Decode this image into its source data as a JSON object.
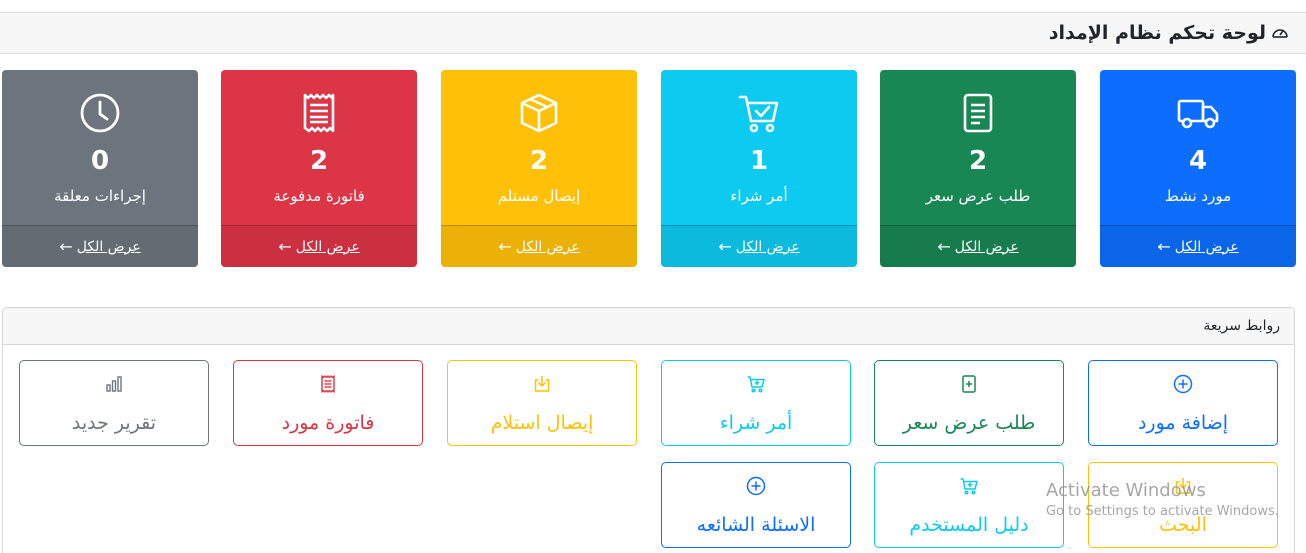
{
  "header": {
    "title": "لوحة تحكم نظام الإمداد",
    "icon": "speedometer-icon"
  },
  "stats": [
    {
      "key": "suppliers",
      "count": "4",
      "label": "مورد نشط",
      "link": "عرض الكل",
      "icon": "truck-icon",
      "color": "#0d6efd"
    },
    {
      "key": "quotes",
      "count": "2",
      "label": "طلب عرض سعر",
      "link": "عرض الكل",
      "icon": "document-icon",
      "color": "#198754"
    },
    {
      "key": "purchase_orders",
      "count": "1",
      "label": "أمر شراء",
      "link": "عرض الكل",
      "icon": "cart-check-icon",
      "color": "#0dcaf0"
    },
    {
      "key": "receipts",
      "count": "2",
      "label": "إيصال مستلم",
      "link": "عرض الكل",
      "icon": "box-icon",
      "color": "#ffc107"
    },
    {
      "key": "invoices",
      "count": "2",
      "label": "فاتورة مدفوعة",
      "link": "عرض الكل",
      "icon": "receipt-icon",
      "color": "#dc3545"
    },
    {
      "key": "pending",
      "count": "0",
      "label": "إجراءات معلقة",
      "link": "عرض الكل",
      "icon": "clock-icon",
      "color": "#6c757d"
    }
  ],
  "quick_links": {
    "title": "روابط سريعة",
    "items": [
      {
        "label": "إضافة مورد",
        "icon": "plus-circle-icon",
        "color": "#0d6efd"
      },
      {
        "label": "طلب عرض سعر",
        "icon": "file-plus-icon",
        "color": "#198754"
      },
      {
        "label": "أمر شراء",
        "icon": "cart-plus-icon",
        "color": "#0dcaf0"
      },
      {
        "label": "إيصال استلام",
        "icon": "box-arrow-in-icon",
        "color": "#ffc107"
      },
      {
        "label": "فاتورة مورد",
        "icon": "receipt-icon",
        "color": "#dc3545"
      },
      {
        "label": "تقرير جديد",
        "icon": "bar-chart-icon",
        "color": "#6c757d"
      },
      {
        "label": "البحث",
        "icon": "box-arrow-in-icon",
        "color": "#ffc107"
      },
      {
        "label": "دليل المستخدم",
        "icon": "cart-plus-icon",
        "color": "#0dcaf0"
      },
      {
        "label": "الاسئلة الشائعه",
        "icon": "plus-circle-icon",
        "color": "#0d6efd"
      }
    ]
  },
  "watermark": {
    "line1": "Activate Windows",
    "line2": "Go to Settings to activate Windows."
  }
}
